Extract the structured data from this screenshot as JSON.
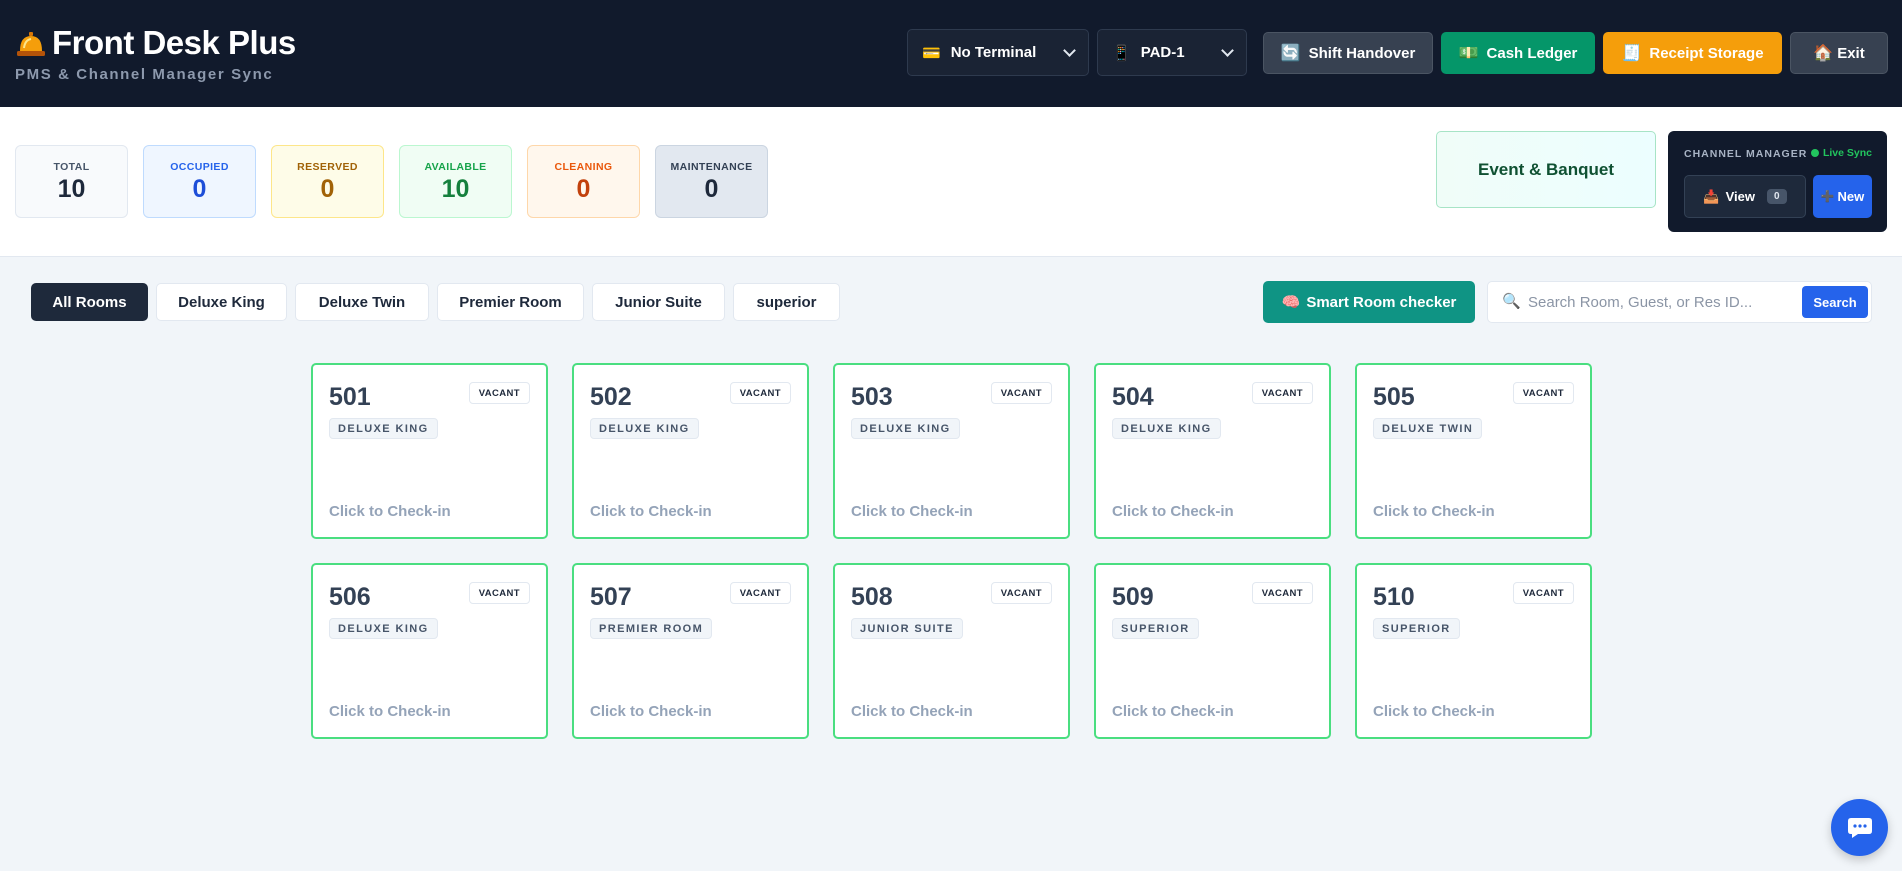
{
  "header": {
    "title": "Front Desk Plus",
    "subtitle": "PMS & Channel Manager Sync",
    "terminal_select": {
      "icon": "💳",
      "value": "No Terminal"
    },
    "pad_select": {
      "icon": "📱",
      "value": "PAD-1"
    },
    "buttons": {
      "shift_handover": {
        "icon": "🔄",
        "label": "Shift Handover",
        "color": "#374151"
      },
      "cash_ledger": {
        "icon": "💵",
        "label": "Cash Ledger",
        "color": "#059669"
      },
      "receipt_storage": {
        "icon": "🧾",
        "label": "Receipt Storage",
        "color": "#f59e0b"
      },
      "exit": {
        "icon": "🏠",
        "label": "Exit",
        "color": "#374151"
      }
    }
  },
  "stats": {
    "total": {
      "label": "TOTAL",
      "value": "10"
    },
    "occupied": {
      "label": "OCCUPIED",
      "value": "0"
    },
    "reserved": {
      "label": "RESERVED",
      "value": "0"
    },
    "available": {
      "label": "AVAILABLE",
      "value": "10"
    },
    "cleaning": {
      "label": "CLEANING",
      "value": "0"
    },
    "maintenance": {
      "label": "MAINTENANCE",
      "value": "0"
    }
  },
  "event_banquet": {
    "label": "Event & Banquet"
  },
  "channel_manager": {
    "title": "CHANNEL MANAGER",
    "sync_status": "Live Sync",
    "view_label": "View",
    "view_icon": "📥",
    "view_count": "0",
    "new_label": "New",
    "new_icon": "➕"
  },
  "filters": {
    "tabs": [
      "All Rooms",
      "Deluxe King",
      "Deluxe Twin",
      "Premier Room",
      "Junior Suite",
      "superior"
    ],
    "active_tab": "All Rooms"
  },
  "smart_checker": {
    "icon": "🧠",
    "label": "Smart Room checker"
  },
  "search": {
    "placeholder": "Search Room, Guest, or Res ID...",
    "button": "Search"
  },
  "rooms": [
    {
      "number": "501",
      "type": "DELUXE KING",
      "status": "VACANT",
      "action": "Click to Check-in"
    },
    {
      "number": "502",
      "type": "DELUXE KING",
      "status": "VACANT",
      "action": "Click to Check-in"
    },
    {
      "number": "503",
      "type": "DELUXE KING",
      "status": "VACANT",
      "action": "Click to Check-in"
    },
    {
      "number": "504",
      "type": "DELUXE KING",
      "status": "VACANT",
      "action": "Click to Check-in"
    },
    {
      "number": "505",
      "type": "DELUXE TWIN",
      "status": "VACANT",
      "action": "Click to Check-in"
    },
    {
      "number": "506",
      "type": "DELUXE KING",
      "status": "VACANT",
      "action": "Click to Check-in"
    },
    {
      "number": "507",
      "type": "PREMIER ROOM",
      "status": "VACANT",
      "action": "Click to Check-in"
    },
    {
      "number": "508",
      "type": "JUNIOR SUITE",
      "status": "VACANT",
      "action": "Click to Check-in"
    },
    {
      "number": "509",
      "type": "SUPERIOR",
      "status": "VACANT",
      "action": "Click to Check-in"
    },
    {
      "number": "510",
      "type": "SUPERIOR",
      "status": "VACANT",
      "action": "Click to Check-in"
    }
  ],
  "icons": {
    "brand": "bell-icon",
    "search": "search-icon",
    "chat": "chat-icon"
  },
  "colors": {
    "accent": "#2563eb",
    "vacant_border": "#4ade80",
    "header_bg": "#111a2c"
  }
}
